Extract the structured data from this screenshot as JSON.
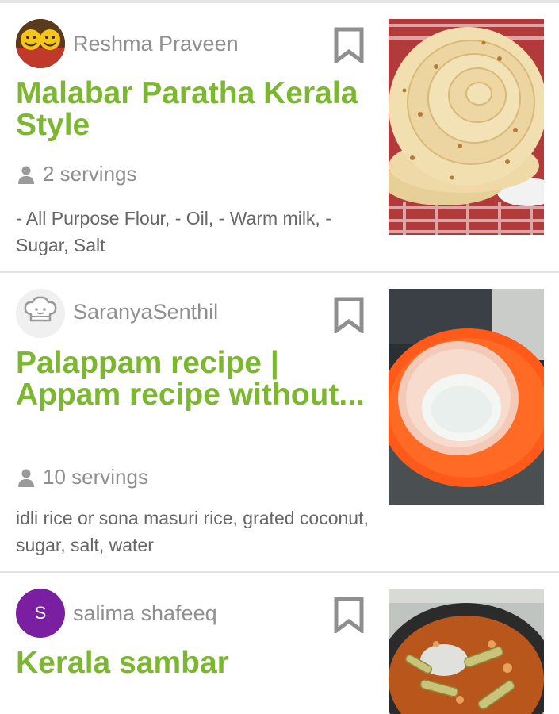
{
  "recipes": [
    {
      "author": "Reshma Praveen",
      "title": "Malabar Paratha Kerala Style",
      "servings": "2 servings",
      "ingredients": "- All Purpose Flour, - Oil, - Warm milk, - Sugar, Salt"
    },
    {
      "author": "SaranyaSenthil",
      "title": "Palappam recipe | Appam recipe without...",
      "servings": "10 servings",
      "ingredients": "idli rice or sona masuri rice, grated coconut, sugar, salt, water"
    },
    {
      "author": "salima shafeeq",
      "avatar_letter": "S",
      "title": "Kerala sambar"
    }
  ],
  "colors": {
    "title_green": "#7cb82f",
    "meta_gray": "#8f8f8f",
    "avatar_purple": "#7b1fa2"
  },
  "icons": {
    "bookmark": "bookmark-outline-icon",
    "servings": "person-icon",
    "default_avatar": "chef-hat-icon"
  }
}
